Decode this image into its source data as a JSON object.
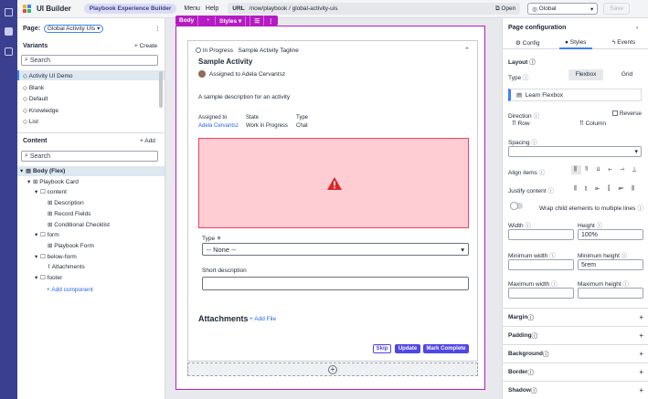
{
  "topbar": {
    "app_title": "UI Builder",
    "experience_pill": "Playbook Experience Builder",
    "menu": "Menu",
    "help": "Help",
    "url_label": "URL",
    "url_value": "/now/playbook / global-activity-uis",
    "open_label": "Open",
    "scope": "Global",
    "save": "Save",
    "logo_colors": [
      "#f0b429",
      "#3b82f6",
      "#ef4444",
      "#22c55e"
    ]
  },
  "left": {
    "page_label": "Page:",
    "page_value": "Global Activity UIs",
    "variants_title": "Variants",
    "create": "+ Create",
    "search_placeholder": "Search",
    "variants": [
      "Activity UI Demo",
      "Blank",
      "Default",
      "Knowledge",
      "List"
    ],
    "content_title": "Content",
    "add": "+ Add",
    "content_search_placeholder": "Search",
    "tree": [
      {
        "label": "Body (Flex)",
        "level": 0,
        "icon": "grid",
        "toggle": "▾"
      },
      {
        "label": "Playbook Card",
        "level": 1,
        "icon": "component",
        "toggle": "▾"
      },
      {
        "label": "content",
        "level": 2,
        "icon": "box",
        "toggle": "▾"
      },
      {
        "label": "Description",
        "level": 3,
        "icon": "component",
        "toggle": ""
      },
      {
        "label": "Record Fields",
        "level": 3,
        "icon": "component",
        "toggle": ""
      },
      {
        "label": "Conditional Checklist",
        "level": 3,
        "icon": "component",
        "toggle": ""
      },
      {
        "label": "form",
        "level": 2,
        "icon": "box",
        "toggle": "▾"
      },
      {
        "label": "Playbook Form",
        "level": 3,
        "icon": "component",
        "toggle": ""
      },
      {
        "label": "below-form",
        "level": 2,
        "icon": "box",
        "toggle": "▾"
      },
      {
        "label": "Attachments",
        "level": 3,
        "icon": "clip",
        "toggle": ""
      },
      {
        "label": "footer",
        "level": 2,
        "icon": "box",
        "toggle": "▾"
      }
    ],
    "add_component": "+ Add component"
  },
  "canvas": {
    "toolbar": {
      "body": "Body",
      "styles": "Styles ▾"
    },
    "status": "In Progress",
    "tagline": "Sample Activity Tagline",
    "title": "Sample Activity",
    "assigned": "Assigned to Adela Cervantsz",
    "description": "A sample description for an activity",
    "fields": [
      {
        "label": "Assigned to",
        "value": "Adela Cervantsz"
      },
      {
        "label": "State",
        "value": "Work in Progress"
      },
      {
        "label": "Type",
        "value": "Chat"
      }
    ],
    "type_label": "Type",
    "type_value": "-- None --",
    "short_desc_label": "Short description",
    "attachments": "Attachments",
    "add_file": "+ Add File",
    "skip": "Skip",
    "update": "Update",
    "mark_complete": "Mark Complete"
  },
  "right": {
    "title": "Page configuration",
    "tabs": [
      "Config",
      "Styles",
      "Events"
    ],
    "layout": "Layout",
    "type_label": "Type",
    "flexbox": "Flexbox",
    "grid": "Grid",
    "learn": "Learn Flexbox",
    "direction": "Direction",
    "reverse": "Reverse",
    "row": "Row",
    "column": "Column",
    "spacing": "Spacing",
    "align_items": "Align items",
    "justify": "Justify content",
    "wrap": "Wrap child elements to multiple lines",
    "width": "Width",
    "height": "Height",
    "height_value": "100%",
    "min_width": "Minimum width",
    "min_height": "Minimum height",
    "min_height_value": "5rem",
    "max_width": "Maximum width",
    "max_height": "Maximum height",
    "sections": [
      "Margin",
      "Padding",
      "Background",
      "Border",
      "Shadow"
    ]
  }
}
